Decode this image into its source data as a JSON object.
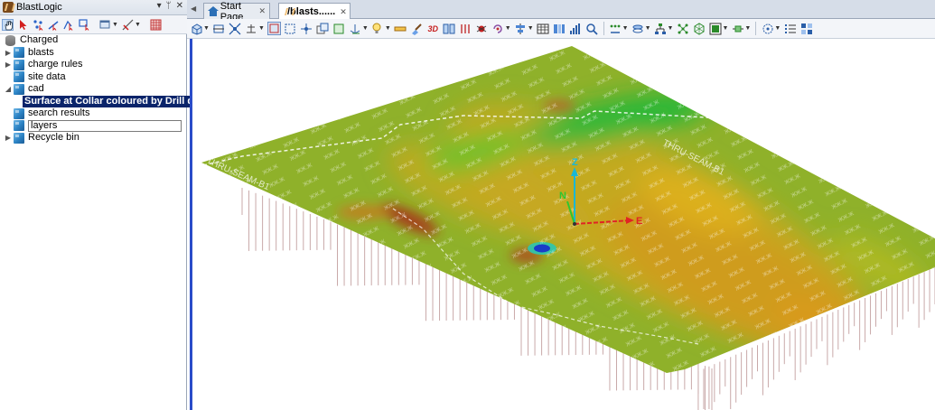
{
  "app": {
    "title": "BlastLogic"
  },
  "left_panel": {
    "title_buttons": [
      "▾",
      "ᛘ",
      "✕"
    ],
    "tree": [
      {
        "label": "Charged",
        "icon": "database-icon",
        "level": 0,
        "arrow": ""
      },
      {
        "label": "blasts",
        "icon": "cube-icon",
        "level": 1,
        "arrow": "▶"
      },
      {
        "label": "charge rules",
        "icon": "cube-icon",
        "level": 1,
        "arrow": "▶"
      },
      {
        "label": "site data",
        "icon": "cube-icon",
        "level": 1,
        "arrow": ""
      },
      {
        "label": "cad",
        "icon": "cube-icon",
        "level": 1,
        "arrow": "◢"
      },
      {
        "label": "Surface at Collar coloured by Drill de...",
        "icon": "grid-surface-icon",
        "level": 2,
        "arrow": "",
        "selected": true
      },
      {
        "label": "search results",
        "icon": "cube-icon",
        "level": 1,
        "arrow": ""
      },
      {
        "label": "layers",
        "icon": "cube-icon",
        "level": 1,
        "arrow": "",
        "editing": true
      },
      {
        "label": "Recycle bin",
        "icon": "cube-icon",
        "level": 1,
        "arrow": "▶"
      }
    ]
  },
  "tabs": [
    {
      "label": "Start Page",
      "close": "✕"
    },
    {
      "label": "/blasts......",
      "close": "✕"
    }
  ],
  "viewport": {
    "axis_labels": {
      "z": "Z",
      "n": "N",
      "e": "E"
    },
    "seam_label": "THRU-SEAM-B1",
    "colors": {
      "high_green": "#1fb83a",
      "mid_yellow": "#c8b21a",
      "orange": "#d68a1c",
      "red": "#a8341a",
      "base_olive": "#8fb12a",
      "blue_spot": "#1a3cc8",
      "axis_z": "#19b7d6",
      "axis_n": "#2fc62f",
      "axis_e": "#e02424"
    }
  }
}
